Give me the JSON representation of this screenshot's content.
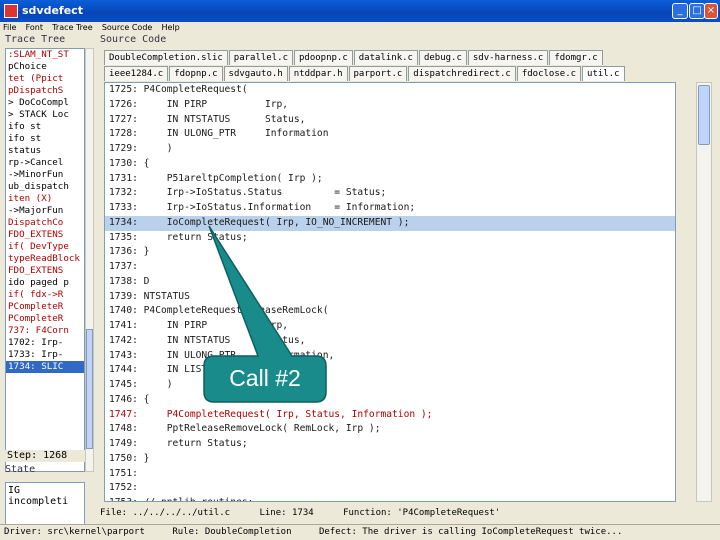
{
  "window": {
    "title": "sdvdefect"
  },
  "menu": [
    "File",
    "Font",
    "Trace Tree",
    "Source Code",
    "Help"
  ],
  "trace_panel": {
    "label": "Trace Tree",
    "rows": [
      {
        "text": ":SLAM_NT_ST",
        "color": "red"
      },
      {
        "text": "pChoice",
        "color": "black"
      },
      {
        "text": "tet (Ppict",
        "color": "red"
      },
      {
        "text": "pDispatchS",
        "color": "red"
      },
      {
        "text": "> DoCoCompl",
        "color": "black"
      },
      {
        "text": "> STACK Loc",
        "color": "black"
      },
      {
        "text": "ifo  st",
        "color": "black"
      },
      {
        "text": "ifo  st",
        "color": "black"
      },
      {
        "text": "status",
        "color": "black"
      },
      {
        "text": "rp->Cancel",
        "color": "black"
      },
      {
        "text": "->MinorFun",
        "color": "black"
      },
      {
        "text": "ub_dispatch",
        "color": "black"
      },
      {
        "text": "iten (X)",
        "color": "red"
      },
      {
        "text": "->MajorFun",
        "color": "black"
      },
      {
        "text": "DispatchCo",
        "color": "red"
      },
      {
        "text": "FDO_EXTENS",
        "color": "red"
      },
      {
        "text": "if( DevType",
        "color": "red"
      },
      {
        "text": "typeReadBlock",
        "color": "red"
      },
      {
        "text": "FDO_EXTENS",
        "color": "red"
      },
      {
        "text": "ido paged p",
        "color": "black"
      },
      {
        "text": "if( fdx->R",
        "color": "red"
      },
      {
        "text": "PCompleteR",
        "color": "red"
      },
      {
        "text": "PCompleteR",
        "color": "red"
      },
      {
        "text": "737: F4Corn",
        "color": "red"
      },
      {
        "text": "1702: Irp-",
        "color": "black"
      },
      {
        "text": "1733: Irp-",
        "color": "black"
      },
      {
        "text": "1734: SLIC",
        "color": "sel"
      }
    ],
    "step": "Step: 1268",
    "state_label": "State",
    "state_lines": [
      "IG",
      "incompleti"
    ]
  },
  "source_panel": {
    "label": "Source Code",
    "tabs_row1": [
      "DoubleCompletion.slic",
      "parallel.c",
      "pdoopnp.c",
      "datalink.c",
      "debug.c",
      "sdv-harness.c",
      "fdomgr.c"
    ],
    "tabs_row2": [
      "ieee1284.c",
      "fdopnp.c",
      "sdvgauto.h",
      "ntddpar.h",
      "parport.c",
      "dispatchredirect.c",
      "fdoclose.c",
      "util.c"
    ],
    "active_tab": "util.c",
    "lines": [
      {
        "text": "1725: P4CompleteRequest(",
        "color": "black"
      },
      {
        "text": "1726:     IN PIRP          Irp,",
        "color": "black"
      },
      {
        "text": "1727:     IN NTSTATUS      Status,",
        "color": "black"
      },
      {
        "text": "1728:     IN ULONG_PTR     Information",
        "color": "black"
      },
      {
        "text": "1729:     )",
        "color": "black"
      },
      {
        "text": "1730: {",
        "color": "black"
      },
      {
        "text": "1731:     P51areltpCompletion( Irp );",
        "color": "black"
      },
      {
        "text": "1732:     Irp->IoStatus.Status         = Status;",
        "color": "black"
      },
      {
        "text": "1733:     Irp->IoStatus.Information    = Information;",
        "color": "black"
      },
      {
        "text": "1734:     IoCompleteRequest( Irp, IO_NO_INCREMENT );",
        "color": "hl"
      },
      {
        "text": "1735:     return Status;",
        "color": "black"
      },
      {
        "text": "1736: }",
        "color": "black"
      },
      {
        "text": "1737:",
        "color": "black"
      },
      {
        "text": "1738: D",
        "color": "black"
      },
      {
        "text": "1739: NTSTATUS",
        "color": "black"
      },
      {
        "text": "1740: P4CompleteRequestReleaseRemLock(",
        "color": "black"
      },
      {
        "text": "1741:     IN PIRP          Irp,",
        "color": "black"
      },
      {
        "text": "1742:     IN NTSTATUS      Status,",
        "color": "black"
      },
      {
        "text": "1743:     IN ULONG_PTR     Information,",
        "color": "black"
      },
      {
        "text": "1744:     IN LIST          RemLock",
        "color": "black"
      },
      {
        "text": "1745:     )",
        "color": "black"
      },
      {
        "text": "1746: {",
        "color": "black"
      },
      {
        "text": "1747:     P4CompleteRequest( Irp, Status, Information );",
        "color": "red"
      },
      {
        "text": "1748:     PptReleaseRemoveLock( RemLock, Irp );",
        "color": "black"
      },
      {
        "text": "1749:     return Status;",
        "color": "black"
      },
      {
        "text": "1750: }",
        "color": "black"
      },
      {
        "text": "1751:",
        "color": "black"
      },
      {
        "text": "1752:",
        "color": "black"
      },
      {
        "text": "1753: // pptlib routines:",
        "color": "black"
      }
    ]
  },
  "info_line": {
    "file": "File: ../../../../util.c",
    "line": "Line: 1734",
    "function": "Function: 'P4CompleteRequest'"
  },
  "status_bar": {
    "driver": "Driver: src\\kernel\\parport",
    "rule": "Rule: DoubleCompletion",
    "defect": "Defect: The driver is calling IoCompleteRequest twice..."
  },
  "callout": {
    "label": "Call #2",
    "fill": "#1a8b8b",
    "stroke": "#0e5f5f"
  }
}
